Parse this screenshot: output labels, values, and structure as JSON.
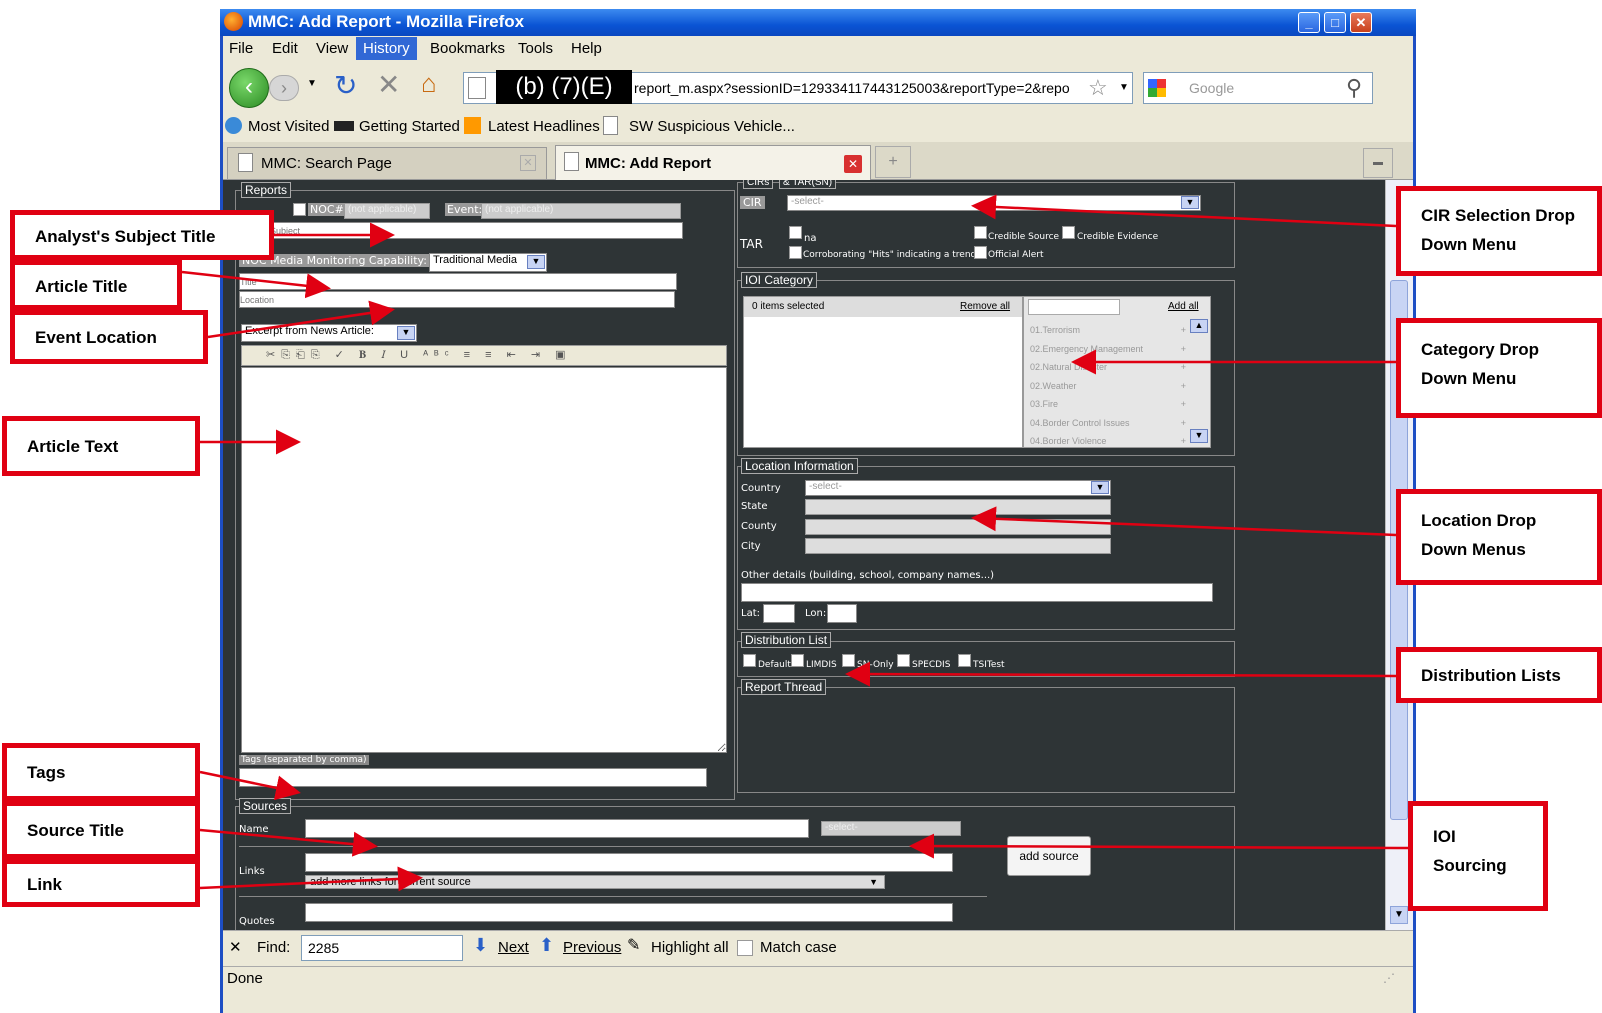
{
  "window": {
    "title": "MMC: Add Report - Mozilla Firefox"
  },
  "menu": [
    "File",
    "Edit",
    "View",
    "History",
    "Bookmarks",
    "Tools",
    "Help"
  ],
  "nav": {
    "redaction": "(b) (7)(E)",
    "url": "report_m.aspx?sessionID=129334117443125003&reportType=2&repo",
    "search_placeholder": "Google"
  },
  "bookmarks": [
    "Most Visited",
    "Getting Started",
    "Latest Headlines",
    "SW Suspicious Vehicle..."
  ],
  "tabs": [
    "MMC: Search Page",
    "MMC: Add Report"
  ],
  "reports": {
    "legend": "Reports",
    "noc_label": "NOC#:",
    "noc_value": "(not applicable)",
    "event_label": "Event:",
    "event_value": "(not applicable)",
    "subject_placeholder": "Subject",
    "capability_label": "NOC Media Monitoring Capability:",
    "capability_value": "Traditional Media",
    "title_placeholder": "Title",
    "location_placeholder": "Location",
    "excerpt_label": "Excerpt from News Article:",
    "tags_label": "Tags (separated by comma)"
  },
  "cirs": {
    "legend": "CIRs",
    "legend2": "& TAR(SN)",
    "cir_label": "CIR",
    "cir_value": "-select-",
    "tar_label": "TAR",
    "options": [
      "Credible Source",
      "Credible Evidence",
      "Corroborating \"Hits\" indicating a trend",
      "Official Alert"
    ]
  },
  "ioi": {
    "legend": "IOI Category",
    "selected": "0 items selected",
    "remove_all": "Remove all",
    "add_all": "Add all",
    "items": [
      "01.Terrorism",
      "02.Emergency Management",
      "02.Natural Disaster",
      "02.Weather",
      "03.Fire",
      "04.Border Control Issues",
      "04.Border Violence"
    ]
  },
  "location": {
    "legend": "Location Information",
    "country": "Country",
    "country_value": "-select-",
    "state": "State",
    "county": "County",
    "city": "City",
    "other": "Other details (building, school, company names...)",
    "lat": "Lat:",
    "lon": "Lon:"
  },
  "distribution": {
    "legend": "Distribution List",
    "items": [
      "Default",
      "LIMDIS",
      "SN-Only",
      "SPECDIS",
      "TSITest"
    ]
  },
  "thread": {
    "legend": "Report Thread"
  },
  "sources": {
    "legend": "Sources",
    "name": "Name",
    "select": "-select-",
    "links": "Links",
    "add_links": "add more links for current source",
    "quotes": "Quotes",
    "add_source": "add source"
  },
  "find": {
    "label": "Find:",
    "value": "2285",
    "next": "Next",
    "previous": "Previous",
    "highlight": "Highlight all",
    "match": "Match case"
  },
  "status": "Done",
  "callouts": {
    "subject": "Analyst's Subject Title",
    "article_title": "Article Title",
    "event_location": "Event  Location",
    "article_text": "Article Text",
    "tags": "Tags",
    "source_title": "Source Title",
    "link": "Link",
    "cir": "CIR Selection Drop Down Menu",
    "category": "Category Drop Down Menu",
    "location": "Location Drop Down Menus",
    "distribution": "Distribution Lists",
    "ioi": "IOI Sourcing"
  },
  "colors": {
    "callout_border": "#e00012",
    "app_bg": "#2e3436",
    "titlebar": "#0a54d4"
  }
}
